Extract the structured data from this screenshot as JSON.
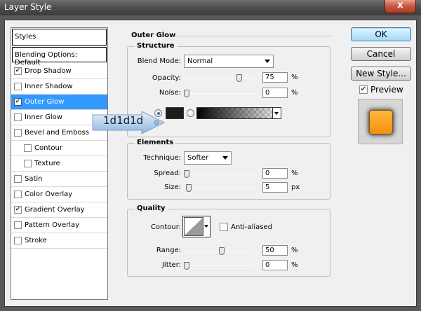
{
  "window": {
    "title": "Layer Style",
    "close_label": "x"
  },
  "styles_panel": {
    "header": "Styles",
    "blending_options": "Blending Options: Default",
    "items": [
      {
        "label": "Drop Shadow",
        "checked": true,
        "sub": false,
        "selected": false
      },
      {
        "label": "Inner Shadow",
        "checked": false,
        "sub": false,
        "selected": false
      },
      {
        "label": "Outer Glow",
        "checked": true,
        "sub": false,
        "selected": true
      },
      {
        "label": "Inner Glow",
        "checked": false,
        "sub": false,
        "selected": false
      },
      {
        "label": "Bevel and Emboss",
        "checked": false,
        "sub": false,
        "selected": false
      },
      {
        "label": "Contour",
        "checked": false,
        "sub": true,
        "selected": false
      },
      {
        "label": "Texture",
        "checked": false,
        "sub": true,
        "selected": false
      },
      {
        "label": "Satin",
        "checked": false,
        "sub": false,
        "selected": false
      },
      {
        "label": "Color Overlay",
        "checked": false,
        "sub": false,
        "selected": false
      },
      {
        "label": "Gradient Overlay",
        "checked": true,
        "sub": false,
        "selected": false
      },
      {
        "label": "Pattern Overlay",
        "checked": false,
        "sub": false,
        "selected": false
      },
      {
        "label": "Stroke",
        "checked": false,
        "sub": false,
        "selected": false
      }
    ]
  },
  "outer_glow": {
    "title": "Outer Glow",
    "structure": {
      "title": "Structure",
      "blend_mode_label": "Blend Mode:",
      "blend_mode_value": "Normal",
      "opacity_label": "Opacity:",
      "opacity_value": "75",
      "opacity_unit": "%",
      "opacity_level": 0.75,
      "noise_label": "Noise:",
      "noise_value": "0",
      "noise_unit": "%",
      "noise_level": 0,
      "glow_color": "#1d1d1d",
      "color_mode": "solid"
    },
    "elements": {
      "title": "Elements",
      "technique_label": "Technique:",
      "technique_value": "Softer",
      "spread_label": "Spread:",
      "spread_value": "0",
      "spread_unit": "%",
      "spread_level": 0,
      "size_label": "Size:",
      "size_value": "5",
      "size_unit": "px",
      "size_level": 0.03
    },
    "quality": {
      "title": "Quality",
      "contour_label": "Contour:",
      "anti_aliased_label": "Anti-aliased",
      "anti_aliased_checked": false,
      "range_label": "Range:",
      "range_value": "50",
      "range_unit": "%",
      "range_level": 0.5,
      "jitter_label": "Jitter:",
      "jitter_value": "0",
      "jitter_unit": "%",
      "jitter_level": 0
    }
  },
  "buttons": {
    "ok": "OK",
    "cancel": "Cancel",
    "new_style": "New Style...",
    "preview_label": "Preview",
    "preview_checked": true
  },
  "preview": {
    "swatch_color": "#f7a01e"
  },
  "callout": {
    "text": "1d1d1d"
  }
}
